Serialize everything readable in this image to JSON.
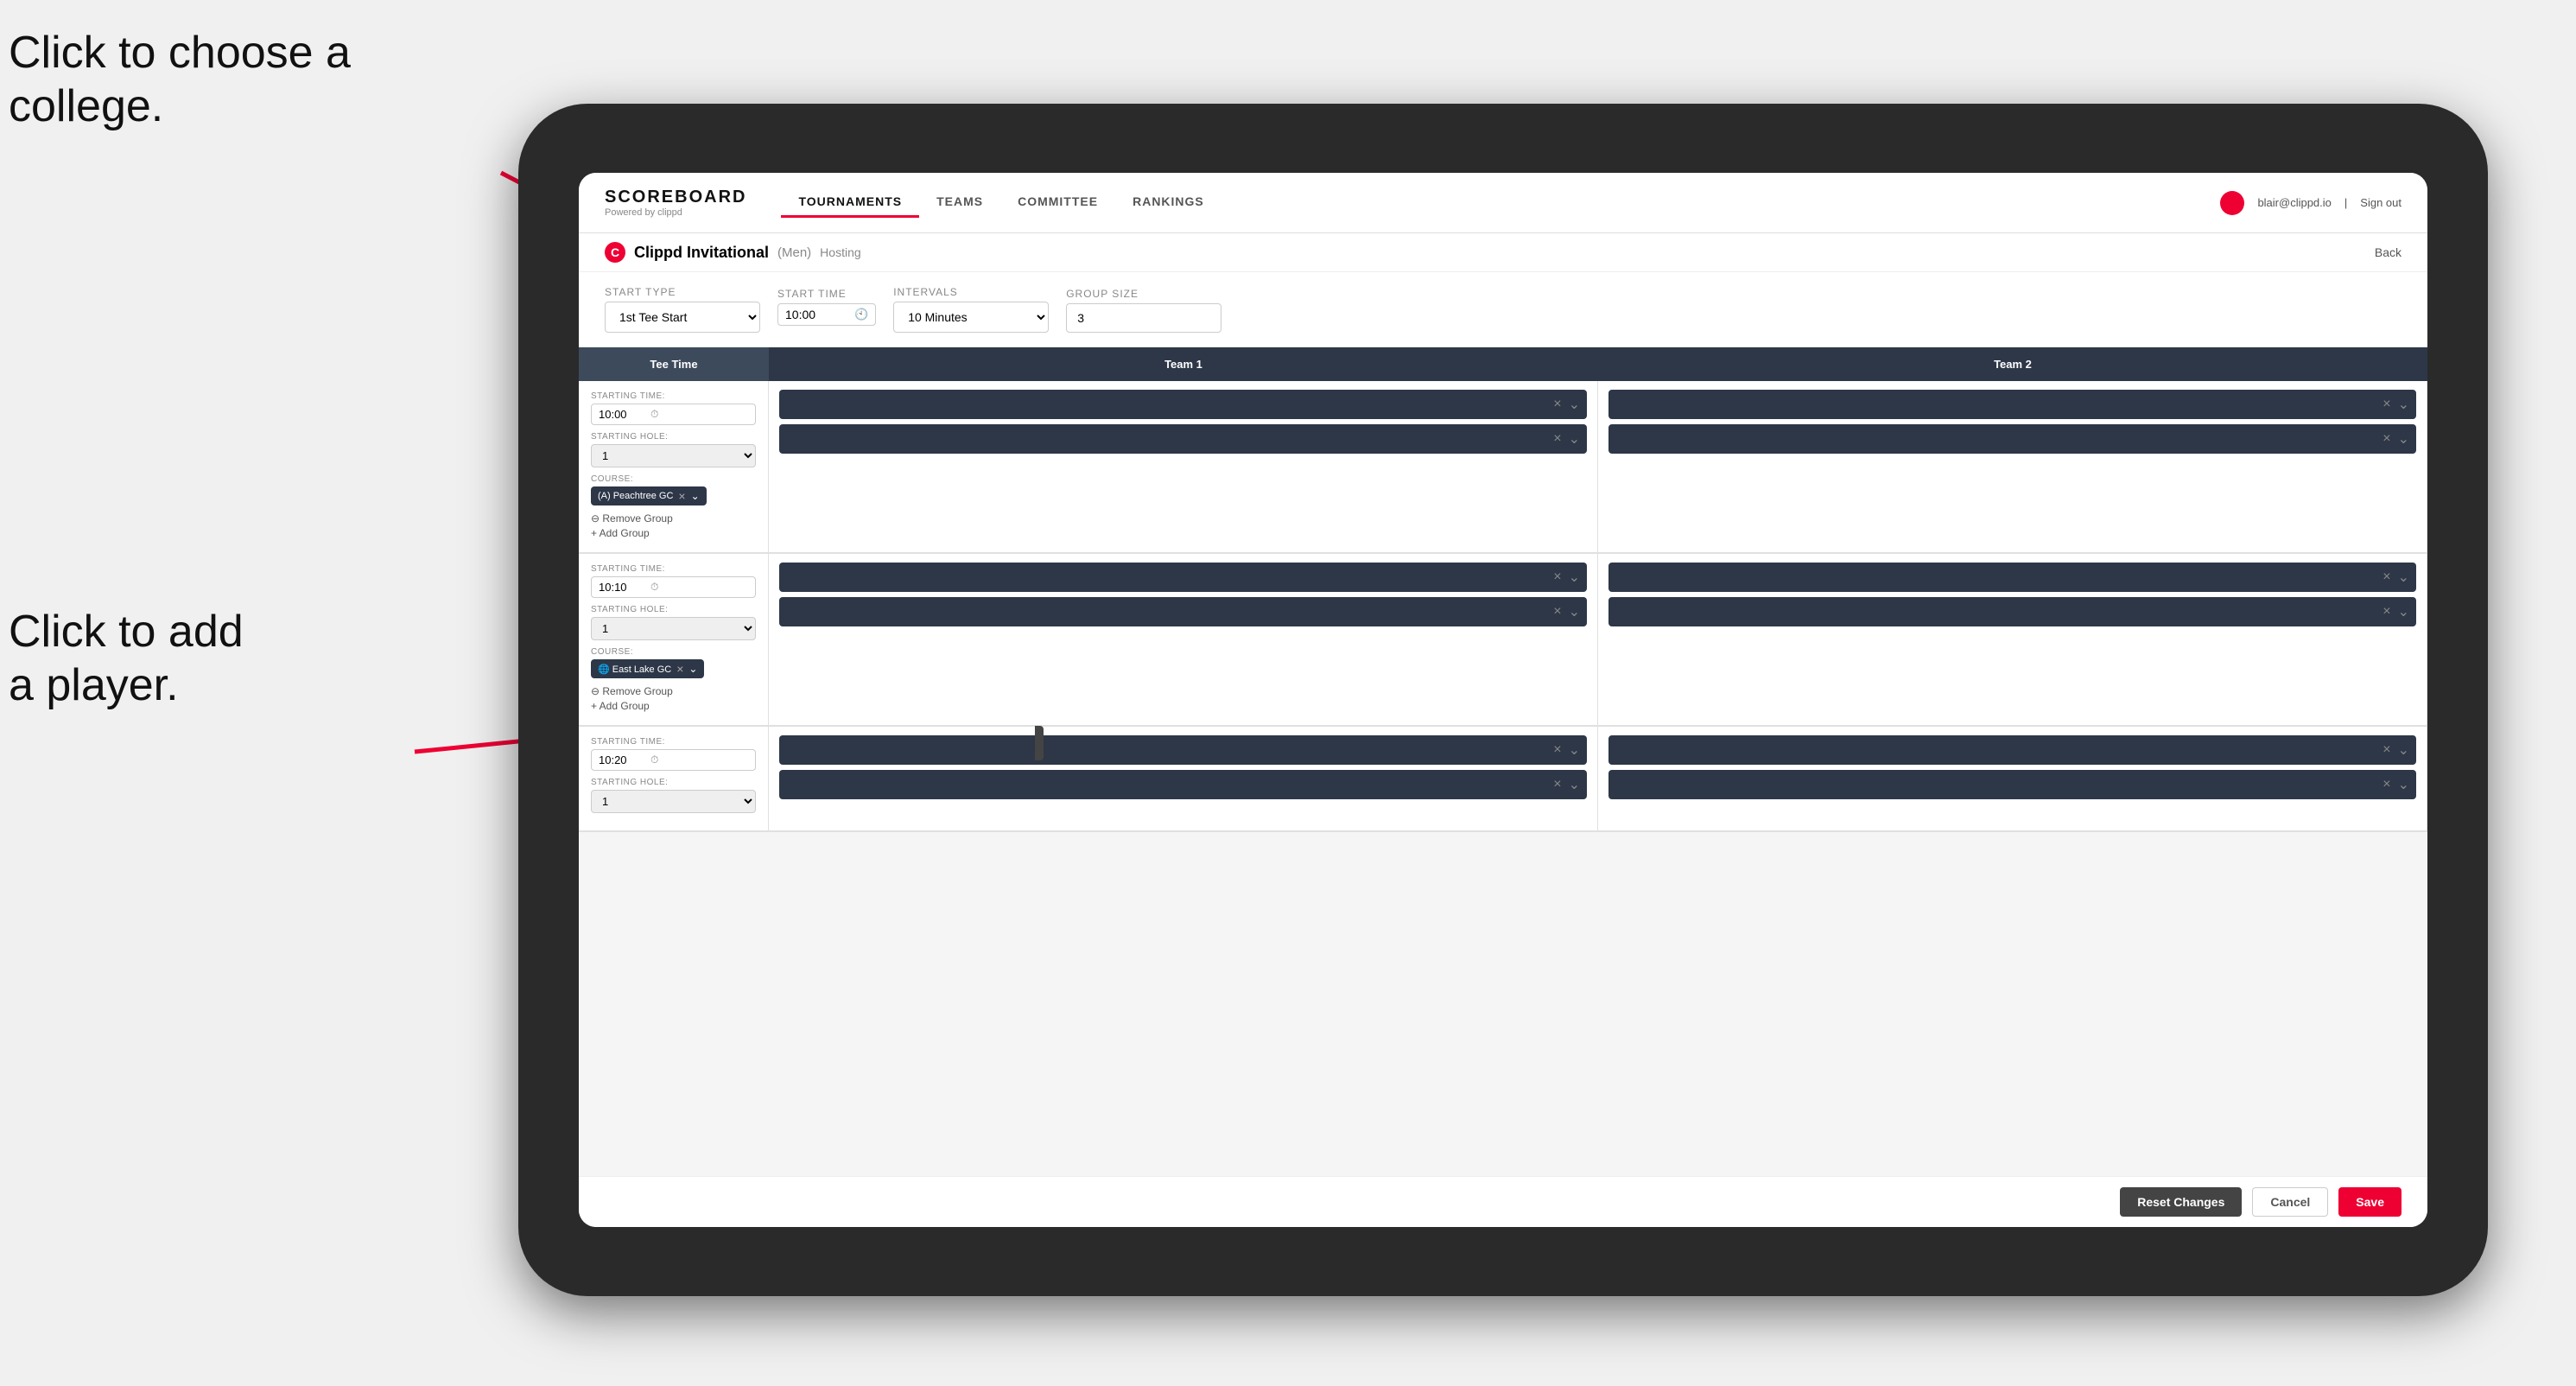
{
  "annotations": {
    "click_college": "Click to choose a\ncollege.",
    "click_player": "Click to add\na player."
  },
  "header": {
    "logo": "SCOREBOARD",
    "logo_sub": "Powered by clippd",
    "nav": [
      "TOURNAMENTS",
      "TEAMS",
      "COMMITTEE",
      "RANKINGS"
    ],
    "active_tab": "TOURNAMENTS",
    "user_email": "blair@clippd.io",
    "sign_out": "Sign out"
  },
  "sub_header": {
    "tournament": "Clippd Invitational",
    "gender": "(Men)",
    "hosting": "Hosting",
    "back": "Back"
  },
  "form": {
    "start_type_label": "Start Type",
    "start_type_value": "1st Tee Start",
    "start_time_label": "Start Time",
    "start_time_value": "10:00",
    "intervals_label": "Intervals",
    "intervals_value": "10 Minutes",
    "group_size_label": "Group Size",
    "group_size_value": "3"
  },
  "table": {
    "col_tee_time": "Tee Time",
    "col_team1": "Team 1",
    "col_team2": "Team 2"
  },
  "tee_times": [
    {
      "starting_time": "10:00",
      "starting_hole": "1",
      "course": "(A) Peachtree GC",
      "remove_group": "Remove Group",
      "add_group": "Add Group",
      "team1_slots": 2,
      "team2_slots": 2
    },
    {
      "starting_time": "10:10",
      "starting_hole": "1",
      "course": "East Lake GC",
      "remove_group": "Remove Group",
      "add_group": "Add Group",
      "team1_slots": 2,
      "team2_slots": 2
    },
    {
      "starting_time": "10:20",
      "starting_hole": "1",
      "course": "",
      "remove_group": "",
      "add_group": "",
      "team1_slots": 2,
      "team2_slots": 2
    }
  ],
  "buttons": {
    "reset": "Reset Changes",
    "cancel": "Cancel",
    "save": "Save"
  },
  "colors": {
    "accent": "#cc0033",
    "dark_bg": "#2d3748",
    "nav_bg": "#ffffff"
  }
}
